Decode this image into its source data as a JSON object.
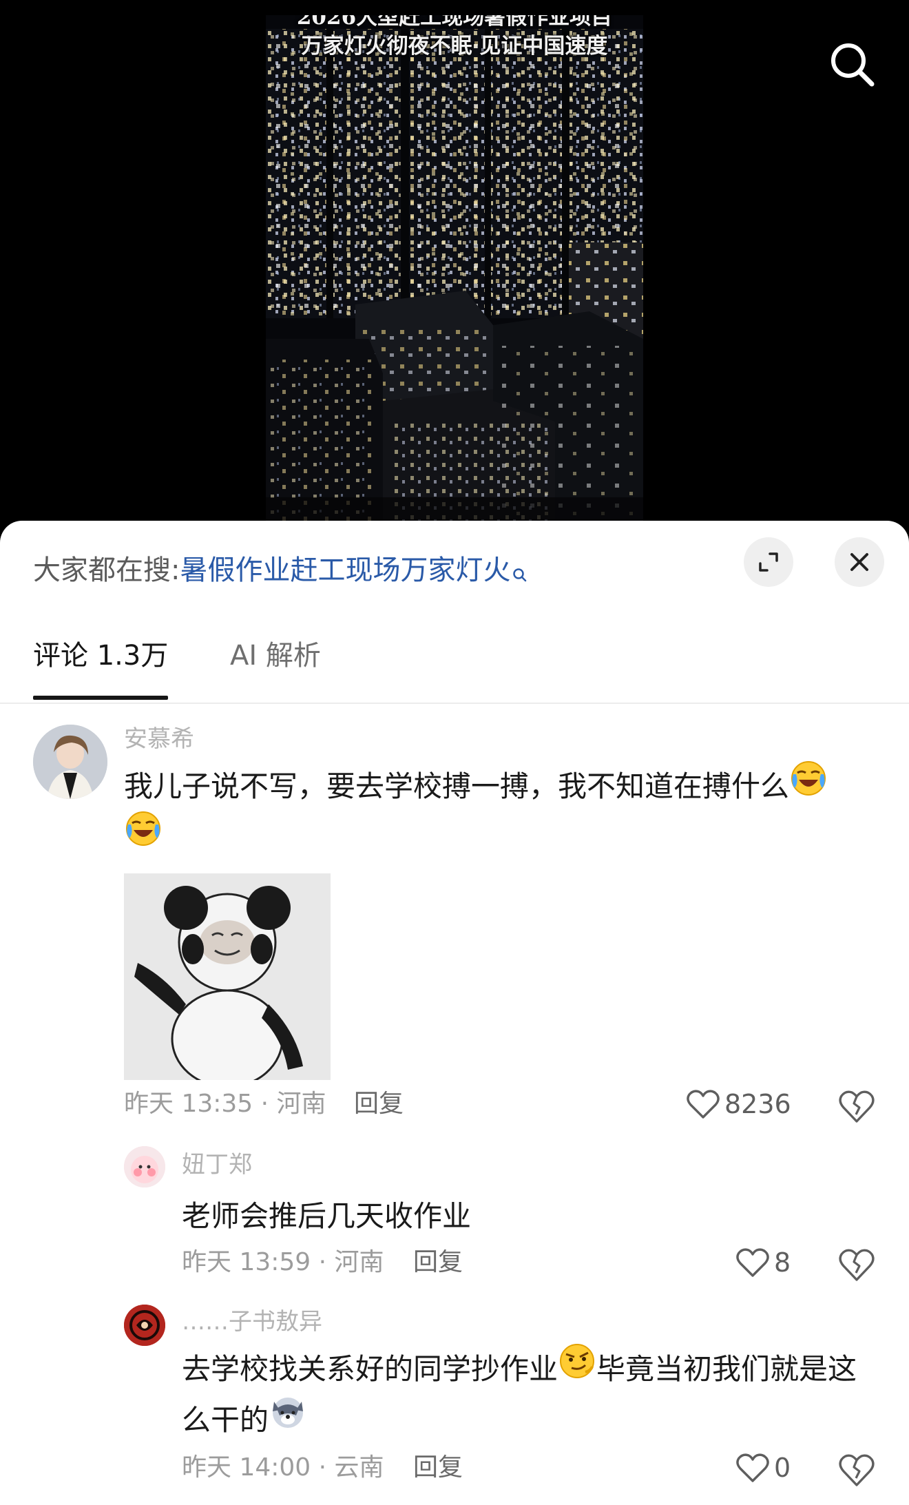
{
  "video": {
    "caption_line1": "2026大型赶工现场暑假作业项目",
    "caption_line2": "万家灯火彻夜不眠 见证中国速度"
  },
  "trend": {
    "label": "大家都在搜:",
    "query": "暑假作业赶工现场万家灯火"
  },
  "tabs": [
    {
      "label": "评论 1.3万",
      "active": true
    },
    {
      "label": "AI 解析",
      "active": false
    }
  ],
  "comments": [
    {
      "username": "安慕希",
      "text": "我儿子说不写，要去学校搏一搏，我不知道在搏什么",
      "emoji": "laugh-cry-emoji",
      "time": "昨天 13:35",
      "location": "河南",
      "reply_label": "回复",
      "likes": "8236",
      "sticker": "panda-meme-sticker"
    },
    {
      "username": "妞丁郑",
      "text": "老师会推后几天收作业",
      "time": "昨天 13:59",
      "location": "河南",
      "reply_label": "回复",
      "likes": "8"
    },
    {
      "username": "……子书敖异",
      "text_part1": "去学校找关系好的同学抄作业",
      "text_part2": "毕竟当初我们就是这么干的",
      "time": "昨天 14:00",
      "location": "云南",
      "reply_label": "回复",
      "likes": "0"
    }
  ],
  "colors": {
    "link_blue": "#2a5aa8",
    "text_dark": "#1a1a1a",
    "meta_gray": "#9c9c9c"
  }
}
